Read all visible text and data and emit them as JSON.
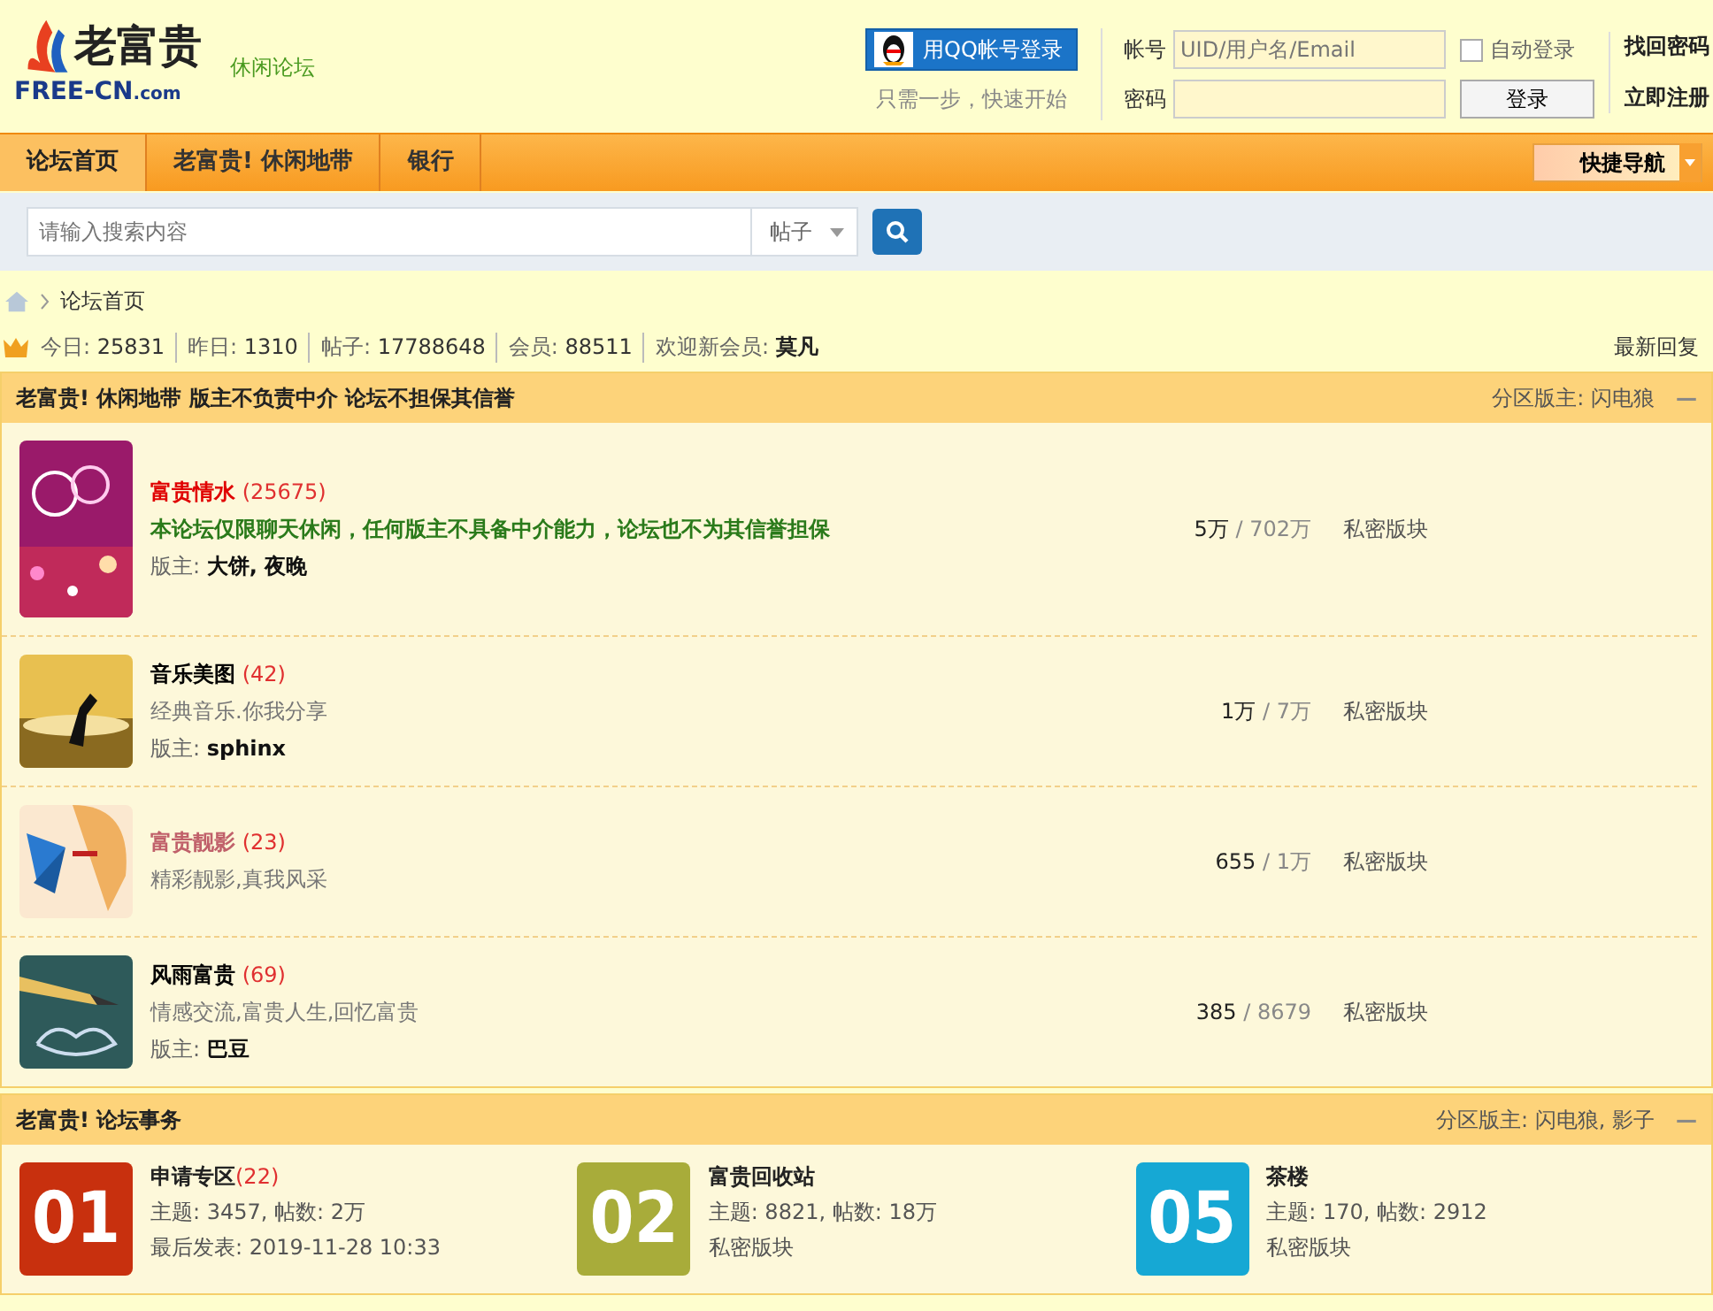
{
  "logo": {
    "mark": "老富贵",
    "domain": "FREE-CN",
    "tld": ".com",
    "tag": "休闲论坛"
  },
  "login": {
    "qq_button": "用QQ帐号登录",
    "qq_hint": "只需一步，快速开始",
    "user_label": "帐号",
    "user_placeholder": "UID/用户名/Email",
    "pass_label": "密码",
    "auto_login": {
      "label": "自动登录",
      "checked": false
    },
    "submit": "登录",
    "forgot": "找回密码",
    "register": "立即注册"
  },
  "nav": {
    "items": [
      {
        "label": "论坛首页",
        "selected": true
      },
      {
        "label": "老富贵! 休闲地带",
        "selected": false
      },
      {
        "label": "银行",
        "selected": false
      }
    ],
    "quick": "快捷导航"
  },
  "search": {
    "placeholder": "请输入搜索内容",
    "scope": "帖子"
  },
  "breadcrumb": [
    "论坛首页"
  ],
  "stats": [
    {
      "label": "今日:",
      "value": "25831"
    },
    {
      "label": "昨日:",
      "value": "1310"
    },
    {
      "label": "帖子:",
      "value": "17788648"
    },
    {
      "label": "会员:",
      "value": "88511"
    },
    {
      "label": "欢迎新会员:",
      "value": "莫凡"
    }
  ],
  "latest_replies": "最新回复",
  "sections": [
    {
      "kind": "list",
      "title": "老富贵! 休闲地带 版主不负责中介 论坛不担保其信誉",
      "mods_label": "分区版主:",
      "mods": "闪电狼",
      "collapse": "—",
      "forums": [
        {
          "name": "富贵情水",
          "color": "#e00000",
          "count": "(25675)",
          "desc": "本论坛仅限聊天休闲，任何版主不具备中介能力，论坛也不为其信誉担保",
          "highlighted": true,
          "mod_label": "版主:",
          "mods": "大饼, 夜晚",
          "threads": "5万",
          "posts": "/ 702万",
          "last": "私密版块"
        },
        {
          "name": "音乐美图",
          "color": "#000000",
          "count": "(42)",
          "desc": "经典音乐.你我分享",
          "highlighted": false,
          "mod_label": "版主:",
          "mods": "sphinx",
          "threads": "1万",
          "posts": "/ 7万",
          "last": "私密版块"
        },
        {
          "name": "富贵靓影",
          "color": "#c0606a",
          "count": "(23)",
          "desc": "精彩靓影,真我风采",
          "highlighted": false,
          "threads": "655",
          "posts": "/ 1万",
          "last": "私密版块"
        },
        {
          "name": "风雨富贵",
          "color": "#000000",
          "count": "(69)",
          "desc": "情感交流,富贵人生,回忆富贵",
          "highlighted": false,
          "mod_label": "版主:",
          "mods": "巴豆",
          "threads": "385",
          "posts": "/ 8679",
          "last": "私密版块"
        }
      ]
    },
    {
      "kind": "grid",
      "title": "老富贵! 论坛事务",
      "mods_label": "分区版主:",
      "mods": "闪电狼, 影子",
      "collapse": "—",
      "forums": [
        {
          "tile": "01",
          "color": "#c8300e",
          "name": "申请专区",
          "count": "(22)",
          "line1": "主题: 3457, 帖数: 2万",
          "line2": "最后发表: 2019-11-28 10:33"
        },
        {
          "tile": "02",
          "color": "#a8ac3a",
          "name": "富贵回收站",
          "line1": "主题: 8821, 帖数: 18万",
          "line2": "私密版块"
        },
        {
          "tile": "05",
          "color": "#16a8d4",
          "name": "茶楼",
          "line1": "主题: 170, 帖数: 2912",
          "line2": "私密版块"
        }
      ]
    }
  ]
}
